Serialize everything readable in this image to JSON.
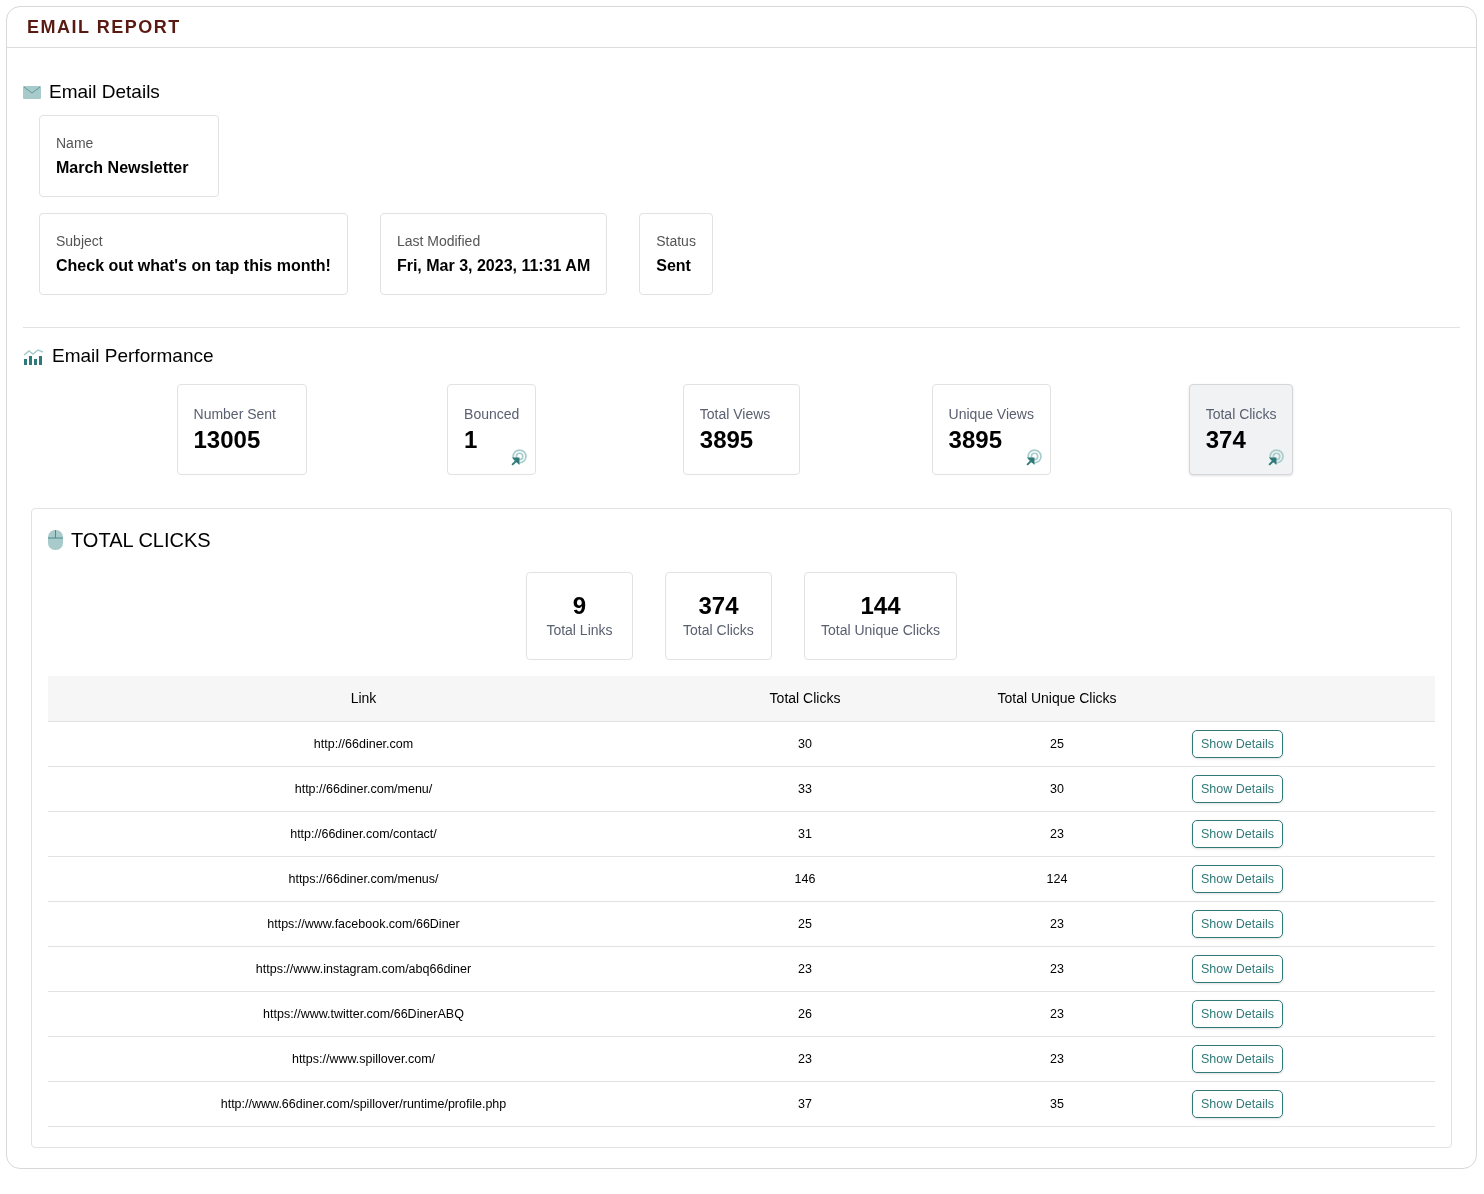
{
  "title": "EMAIL REPORT",
  "details": {
    "heading": "Email Details",
    "name": {
      "label": "Name",
      "value": "March Newsletter"
    },
    "fields": [
      {
        "label": "Subject",
        "value": "Check out what's on tap this month!"
      },
      {
        "label": "Last Modified",
        "value": "Fri, Mar 3, 2023, 11:31 AM"
      },
      {
        "label": "Status",
        "value": "Sent"
      }
    ]
  },
  "performance": {
    "heading": "Email Performance",
    "metrics": [
      {
        "label": "Number Sent",
        "value": "13005",
        "clickable": false,
        "selected": false
      },
      {
        "label": "Bounced",
        "value": "1",
        "clickable": true,
        "selected": false
      },
      {
        "label": "Total Views",
        "value": "3895",
        "clickable": false,
        "selected": false
      },
      {
        "label": "Unique Views",
        "value": "3895",
        "clickable": true,
        "selected": false
      },
      {
        "label": "Total Clicks",
        "value": "374",
        "clickable": true,
        "selected": true
      }
    ]
  },
  "clicks": {
    "heading": "TOTAL CLICKS",
    "summary": [
      {
        "value": "9",
        "label": "Total Links"
      },
      {
        "value": "374",
        "label": "Total Clicks"
      },
      {
        "value": "144",
        "label": "Total Unique Clicks"
      }
    ],
    "columns": [
      "Link",
      "Total Clicks",
      "Total Unique Clicks"
    ],
    "rows": [
      {
        "link": "http://66diner.com",
        "clicks": "30",
        "unique": "25",
        "button": "Show Details"
      },
      {
        "link": "http://66diner.com/menu/",
        "clicks": "33",
        "unique": "30",
        "button": "Show Details"
      },
      {
        "link": "http://66diner.com/contact/",
        "clicks": "31",
        "unique": "23",
        "button": "Show Details"
      },
      {
        "link": "https://66diner.com/menus/",
        "clicks": "146",
        "unique": "124",
        "button": "Show Details"
      },
      {
        "link": "https://www.facebook.com/66Diner",
        "clicks": "25",
        "unique": "23",
        "button": "Show Details"
      },
      {
        "link": "https://www.instagram.com/abq66diner",
        "clicks": "23",
        "unique": "23",
        "button": "Show Details"
      },
      {
        "link": "https://www.twitter.com/66DinerABQ",
        "clicks": "26",
        "unique": "23",
        "button": "Show Details"
      },
      {
        "link": "https://www.spillover.com/",
        "clicks": "23",
        "unique": "23",
        "button": "Show Details"
      },
      {
        "link": "http://www.66diner.com/spillover/runtime/profile.php",
        "clicks": "37",
        "unique": "35",
        "button": "Show Details"
      }
    ]
  }
}
